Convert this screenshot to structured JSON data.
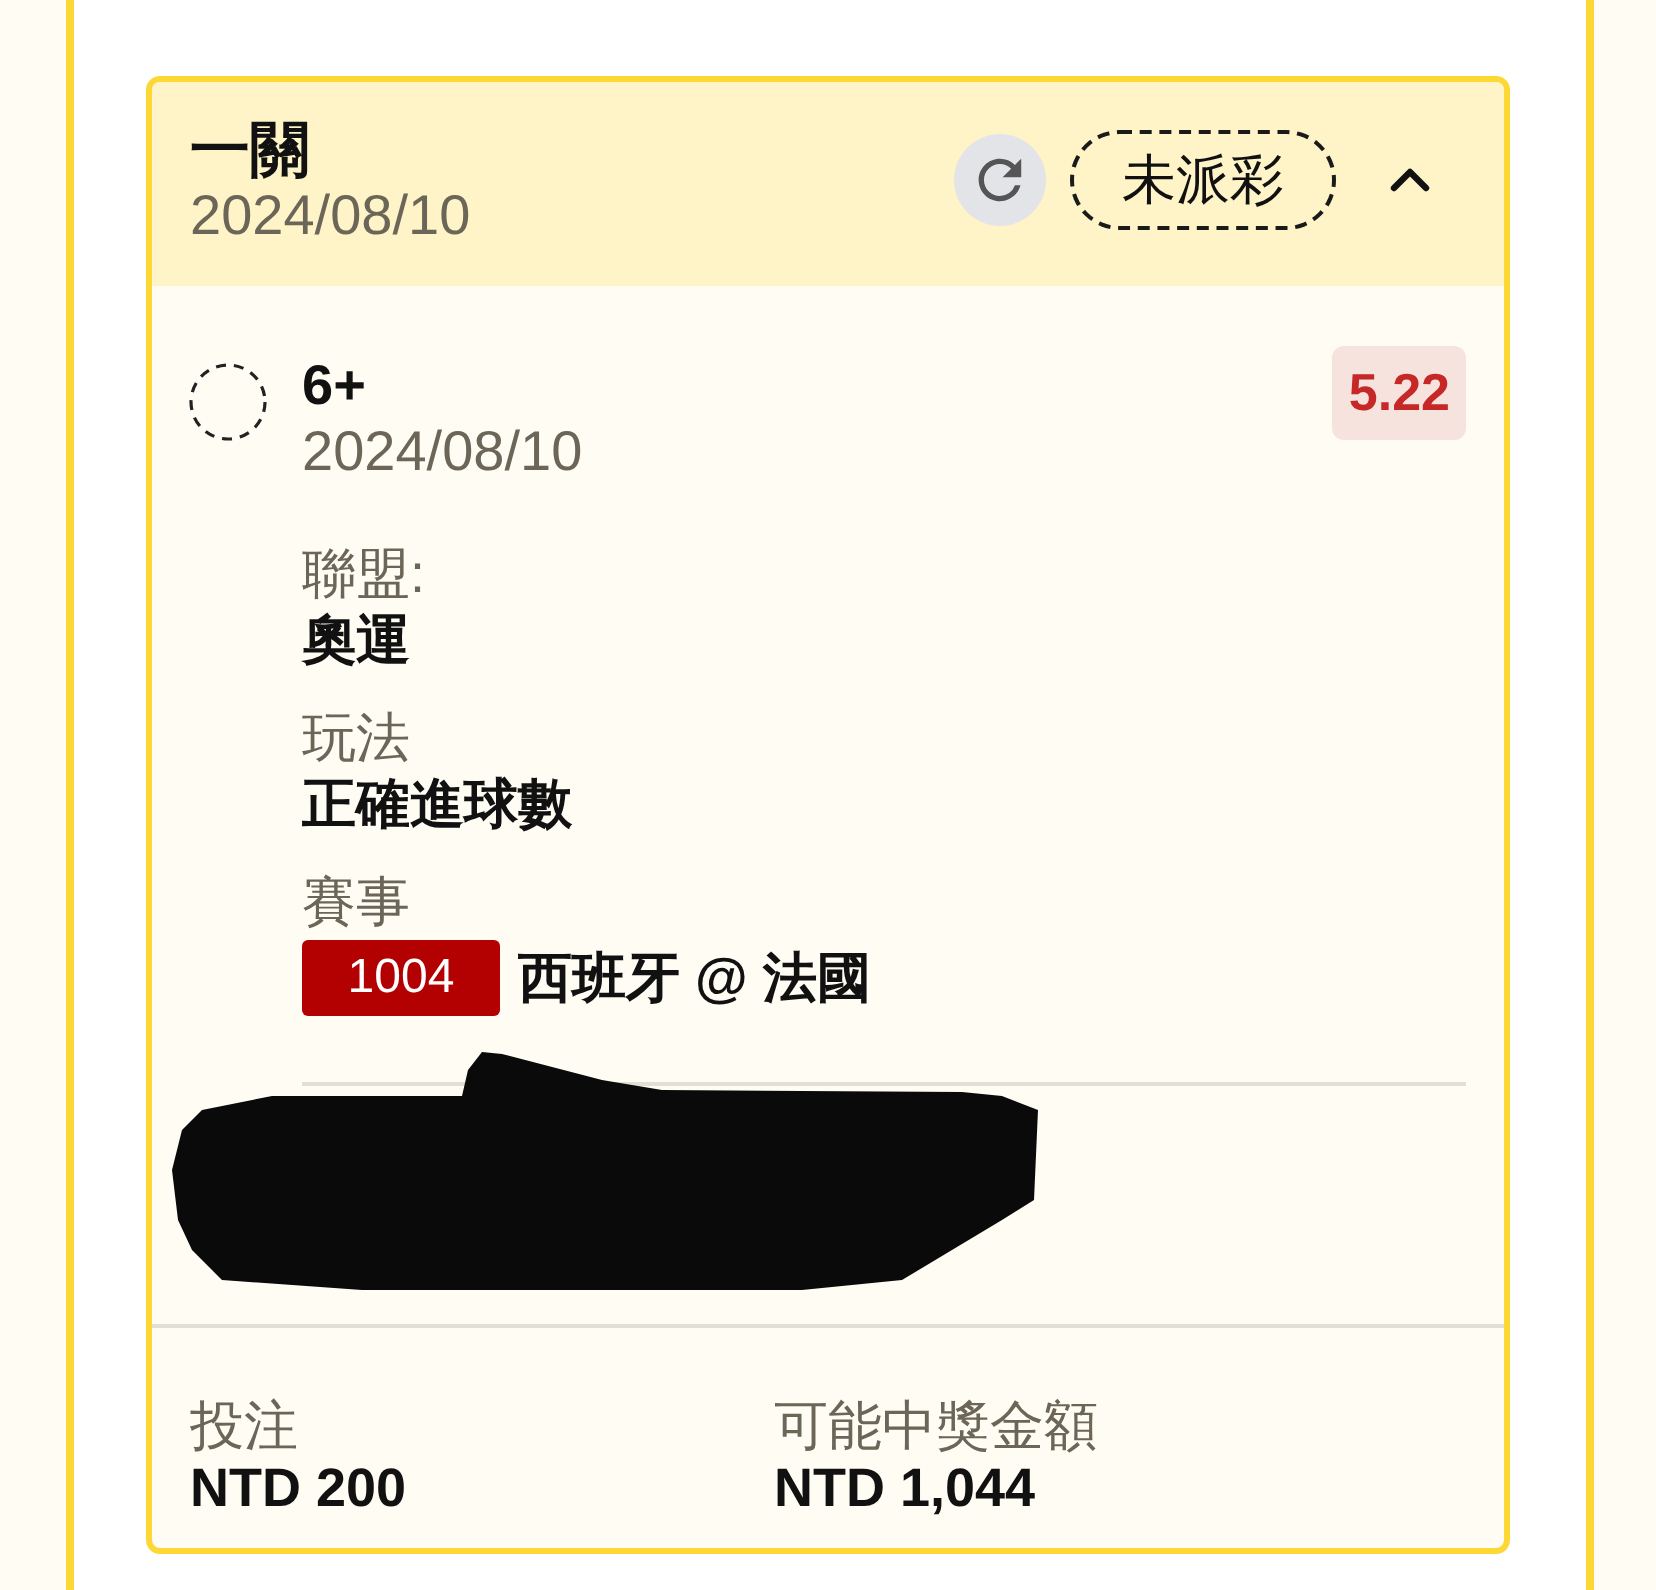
{
  "bet": {
    "type": "一關",
    "date": "2024/08/10",
    "status": "未派彩",
    "expanded": true,
    "selections": [
      {
        "pick": "6+",
        "date": "2024/08/10",
        "odds": "5.22",
        "redacted": true,
        "details": [
          {
            "kind": "text",
            "label": "聯盟:",
            "value": "奧運"
          },
          {
            "kind": "text",
            "label": "玩法",
            "value": "正確進球數"
          },
          {
            "kind": "event",
            "label": "賽事",
            "code": "1004",
            "value": "西班牙 @ 法國"
          }
        ]
      }
    ],
    "summary": [
      {
        "label": "投注",
        "value": "NTD 200"
      },
      {
        "label": "可能中獎金額",
        "value": "NTD 1,044"
      }
    ]
  }
}
